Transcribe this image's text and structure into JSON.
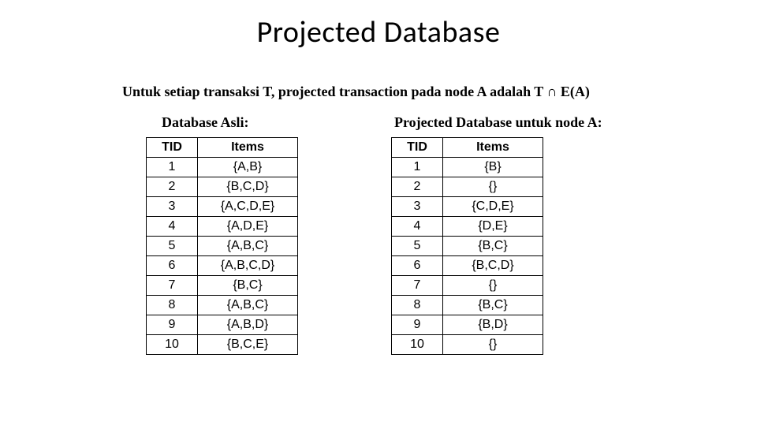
{
  "title": "Projected Database",
  "subtitle": "Untuk setiap transaksi T, projected transaction pada node A adalah  T ∩ E(A)",
  "left": {
    "caption": "Database Asli:",
    "headers": {
      "tid": "TID",
      "items": "Items"
    },
    "rows": [
      {
        "tid": "1",
        "items": "{A,B}"
      },
      {
        "tid": "2",
        "items": "{B,C,D}"
      },
      {
        "tid": "3",
        "items": "{A,C,D,E}"
      },
      {
        "tid": "4",
        "items": "{A,D,E}"
      },
      {
        "tid": "5",
        "items": "{A,B,C}"
      },
      {
        "tid": "6",
        "items": "{A,B,C,D}"
      },
      {
        "tid": "7",
        "items": "{B,C}"
      },
      {
        "tid": "8",
        "items": "{A,B,C}"
      },
      {
        "tid": "9",
        "items": "{A,B,D}"
      },
      {
        "tid": "10",
        "items": "{B,C,E}"
      }
    ]
  },
  "right": {
    "caption": "Projected Database untuk node A:",
    "headers": {
      "tid": "TID",
      "items": "Items"
    },
    "rows": [
      {
        "tid": "1",
        "items": "{B}"
      },
      {
        "tid": "2",
        "items": "{}"
      },
      {
        "tid": "3",
        "items": "{C,D,E}"
      },
      {
        "tid": "4",
        "items": "{D,E}"
      },
      {
        "tid": "5",
        "items": "{B,C}"
      },
      {
        "tid": "6",
        "items": "{B,C,D}"
      },
      {
        "tid": "7",
        "items": "{}"
      },
      {
        "tid": "8",
        "items": "{B,C}"
      },
      {
        "tid": "9",
        "items": "{B,D}"
      },
      {
        "tid": "10",
        "items": "{}"
      }
    ]
  }
}
